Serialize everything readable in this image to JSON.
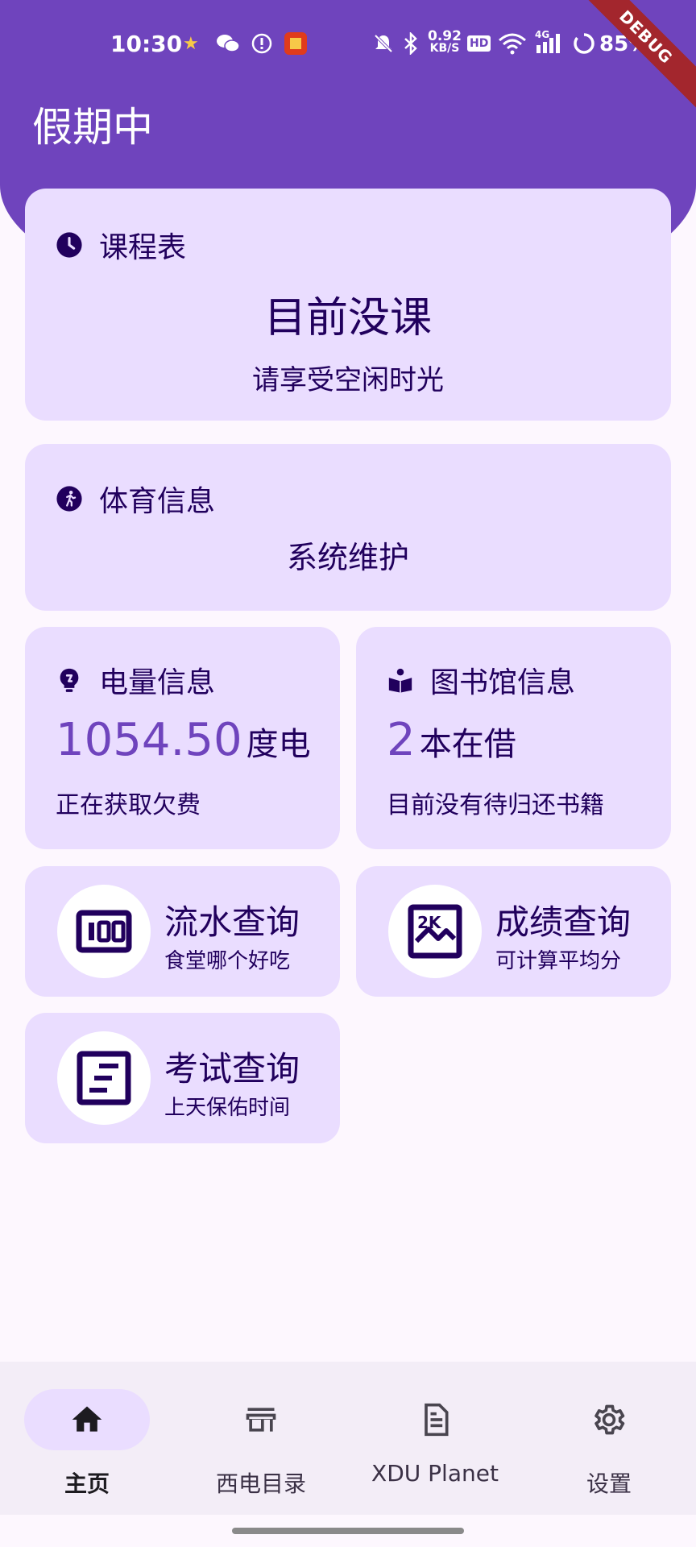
{
  "status_bar": {
    "time": "10:30",
    "net_speed_value": "0.92",
    "net_speed_unit": "KB/S",
    "hd": "HD",
    "network": "4G",
    "battery": "85%",
    "debug": "DEBUG"
  },
  "header": {
    "title": "假期中"
  },
  "schedule_card": {
    "title": "课程表",
    "status": "目前没课",
    "sub": "请享受空闲时光"
  },
  "sport_card": {
    "title": "体育信息",
    "status": "系统维护"
  },
  "electricity_card": {
    "title": "电量信息",
    "value": "1054.50",
    "unit": "度电",
    "sub": "正在获取欠费"
  },
  "library_card": {
    "title": "图书馆信息",
    "value": "2",
    "unit": "本在借",
    "sub": "目前没有待归还书籍"
  },
  "tools": {
    "transactions": {
      "title": "流水查询",
      "sub": "食堂哪个好吃"
    },
    "scores": {
      "title": "成绩查询",
      "sub": "可计算平均分"
    },
    "exams": {
      "title": "考试查询",
      "sub": "上天保佑时间"
    }
  },
  "bottom_nav": {
    "items": [
      {
        "label": "主页",
        "icon": "home-icon",
        "active": true
      },
      {
        "label": "西电目录",
        "icon": "store-icon",
        "active": false
      },
      {
        "label": "XDU Planet",
        "icon": "article-icon",
        "active": false
      },
      {
        "label": "设置",
        "icon": "settings-icon",
        "active": false
      }
    ]
  },
  "colors": {
    "primary": "#6f44bd",
    "card": "#eaddff",
    "on_card": "#21005d",
    "background": "#fdf7fe"
  }
}
